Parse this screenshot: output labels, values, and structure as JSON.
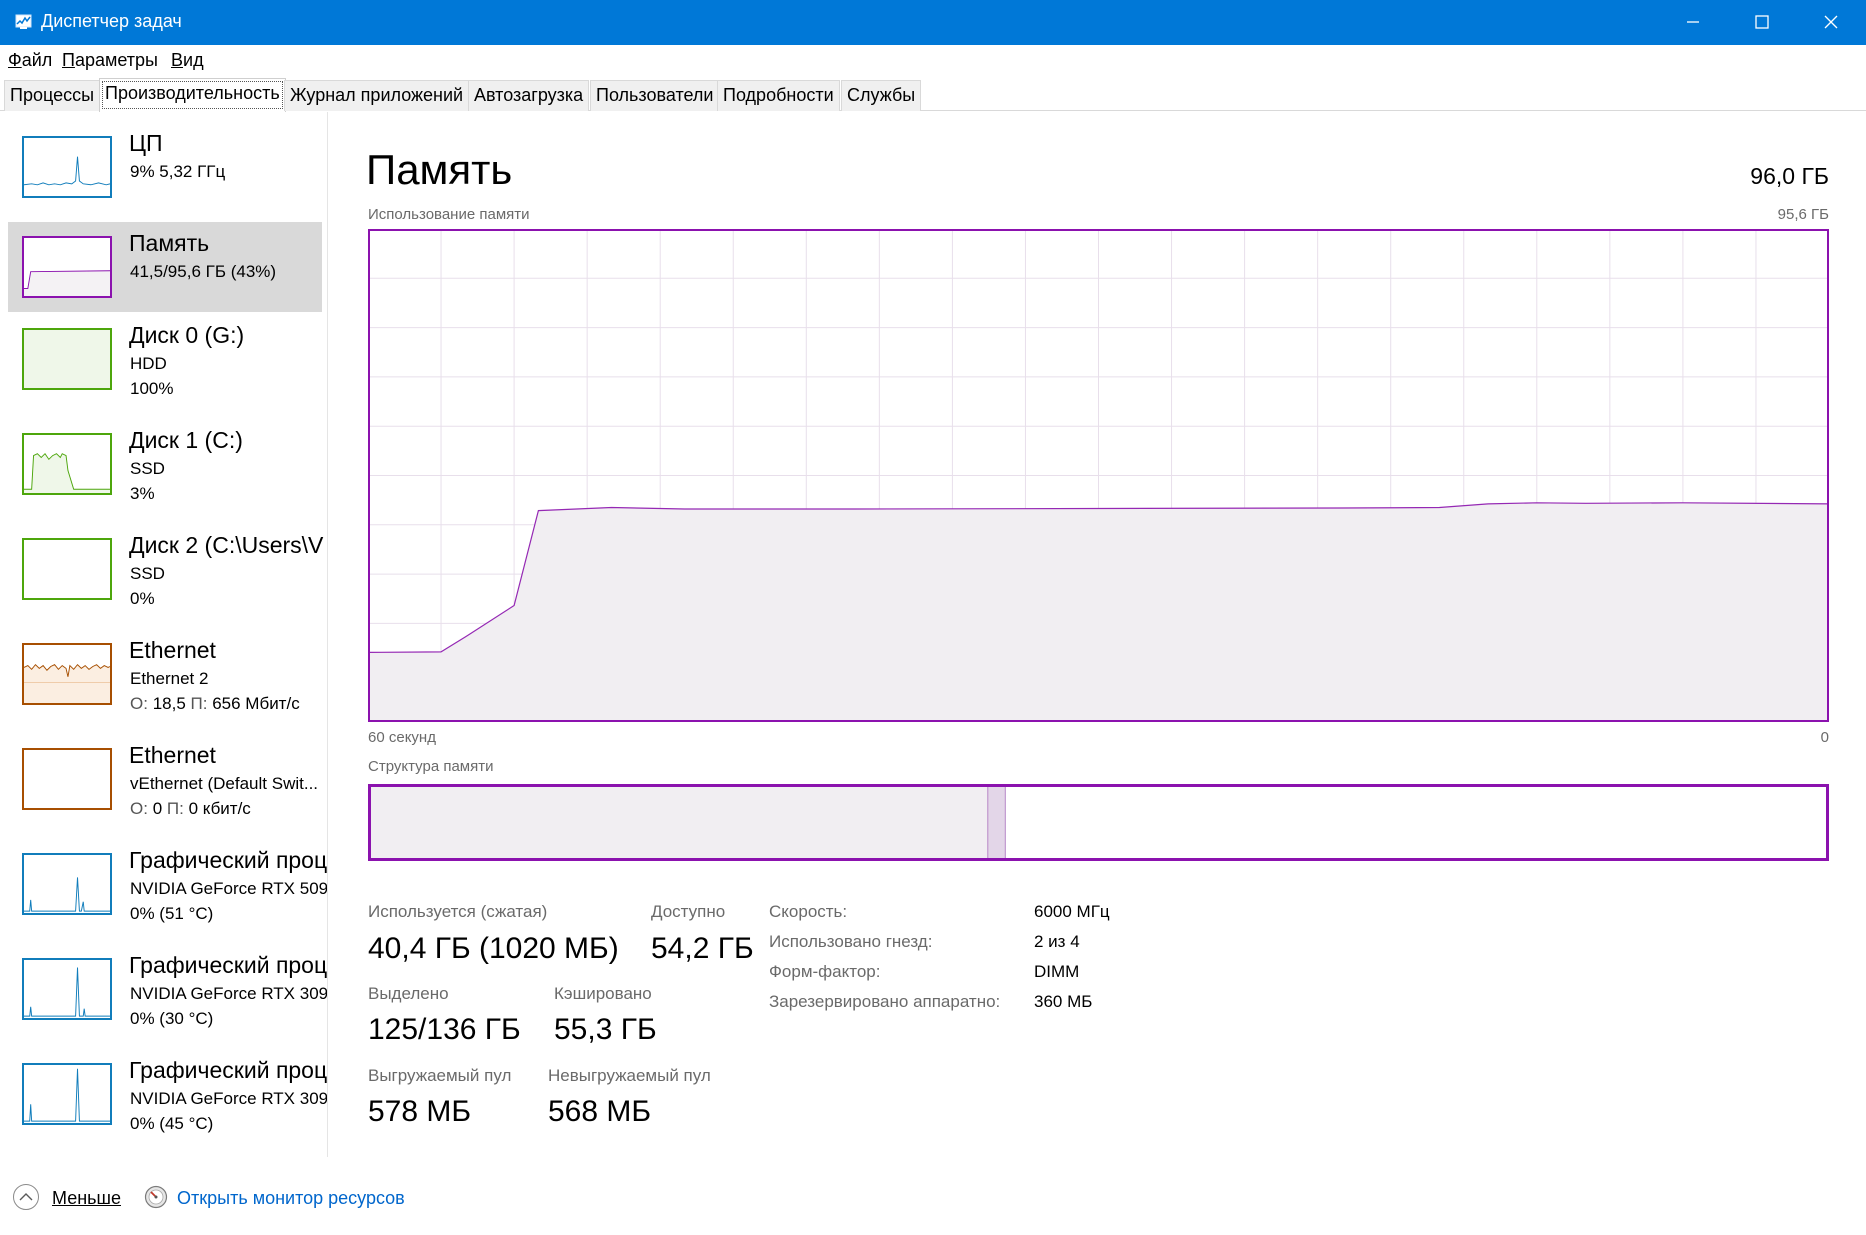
{
  "window": {
    "title": "Диспетчер задач",
    "icon": "task-manager-icon",
    "controls": [
      "minimize-icon",
      "maximize-icon",
      "close-icon"
    ],
    "accent_color": "#0078d7"
  },
  "menu": [
    "Файл",
    "Параметры",
    "Вид"
  ],
  "tabs": [
    "Процессы",
    "Производительность",
    "Журнал приложений",
    "Автозагрузка",
    "Пользователи",
    "Подробности",
    "Службы"
  ],
  "active_tab": "Производительность",
  "sidebar": {
    "items": [
      {
        "title": "ЦП",
        "line2": "9%  5,32 ГГц",
        "line3": "",
        "color": "#117dbb"
      },
      {
        "title": "Память",
        "line2": "41,5/95,6 ГБ (43%)",
        "line3": "",
        "color": "#8b12ae",
        "selected": true
      },
      {
        "title": "Диск 0 (G:)",
        "line2": "HDD",
        "line3": "100%",
        "color": "#4da60c"
      },
      {
        "title": "Диск 1 (C:)",
        "line2": "SSD",
        "line3": "3%",
        "color": "#4da60c"
      },
      {
        "title": "Диск 2 (C:\\Users\\V",
        "line2": "SSD",
        "line3": "0%",
        "color": "#4da60c"
      },
      {
        "title": "Ethernet",
        "line2": "Ethernet 2",
        "line3_label_a": "О:",
        "line3_value_a": "18,5",
        "line3_label_b": "П:",
        "line3_value_b": "656 Мбит/с",
        "color": "#a74f01"
      },
      {
        "title": "Ethernet",
        "line2": "vEthernet (Default Swit...",
        "line3_label_a": "О:",
        "line3_value_a": "0",
        "line3_label_b": "П:",
        "line3_value_b": "0 кбит/с",
        "color": "#a74f01"
      },
      {
        "title": "Графический проц",
        "line2": "NVIDIA GeForce RTX 509",
        "line3": "0% (51 °C)",
        "color": "#117dbb"
      },
      {
        "title": "Графический проц",
        "line2": "NVIDIA GeForce RTX 309",
        "line3": "0% (30 °C)",
        "color": "#117dbb"
      },
      {
        "title": "Графический проц",
        "line2": "NVIDIA GeForce RTX 309",
        "line3": "0% (45 °C)",
        "color": "#117dbb"
      }
    ]
  },
  "main": {
    "title": "Память",
    "total": "96,0 ГБ",
    "usage_label": "Использование памяти",
    "usage_max": "95,6 ГБ",
    "time_left": "60 секунд",
    "time_right": "0",
    "composition_label": "Структура памяти",
    "stats": {
      "in_use_label": "Используется (сжатая)",
      "in_use_value": "40,4 ГБ (1020 МБ)",
      "available_label": "Доступно",
      "available_value": "54,2 ГБ",
      "committed_label": "Выделено",
      "committed_value": "125/136 ГБ",
      "cached_label": "Кэшировано",
      "cached_value": "55,3 ГБ",
      "paged_label": "Выгружаемый пул",
      "paged_value": "578 МБ",
      "nonpaged_label": "Невыгружаемый пул",
      "nonpaged_value": "568 МБ"
    },
    "info": [
      {
        "label": "Скорость:",
        "value": "6000 МГц"
      },
      {
        "label": "Использовано гнезд:",
        "value": "2 из 4"
      },
      {
        "label": "Форм-фактор:",
        "value": "DIMM"
      },
      {
        "label": "Зарезервировано аппаратно:",
        "value": "360 МБ"
      }
    ]
  },
  "memory_usage_series": {
    "unit": "ГБ",
    "max": 95.6,
    "seconds_ago": [
      60,
      57,
      56,
      54,
      53,
      50,
      47,
      40,
      30,
      20,
      16,
      14,
      12,
      10,
      6,
      0
    ],
    "values": [
      13.5,
      13.6,
      16.5,
      22.6,
      41.0,
      41.6,
      41.3,
      41.3,
      41.4,
      41.5,
      41.6,
      42.3,
      42.5,
      42.4,
      42.5,
      42.3
    ]
  },
  "memory_composition": {
    "in_use_fraction": 0.424,
    "modified_fraction": 0.012
  },
  "footer": {
    "fewer_label": "Меньше",
    "fewer_icon": "chevron-up-circle-icon",
    "resmon_label": "Открыть монитор ресурсов",
    "resmon_icon": "resource-monitor-icon"
  }
}
